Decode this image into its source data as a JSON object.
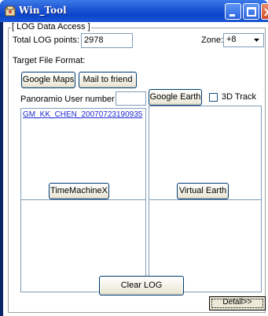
{
  "window": {
    "title": "Win_Tool"
  },
  "group": {
    "label": "[ LOG Data Access ]"
  },
  "log": {
    "total_label": "Total LOG points:",
    "total_value": "2978"
  },
  "zone": {
    "label": "Zone:",
    "value": "+8"
  },
  "format": {
    "label": "Target File Format:"
  },
  "buttons": {
    "google_maps": "Google Maps",
    "mail_to_friend": "Mail to friend",
    "google_earth": "Google Earth",
    "time_machine": "TimeMachineX",
    "virtual_earth": "Virtual Earth",
    "clear_log": "Clear LOG",
    "detail": "Detail>>"
  },
  "panoramio": {
    "label": "Panoramio User number",
    "value": ""
  },
  "track": {
    "label": "3D Track",
    "checked": false
  },
  "file_list": {
    "items": [
      "GM_KK_CHEN_20070723190935"
    ]
  }
}
